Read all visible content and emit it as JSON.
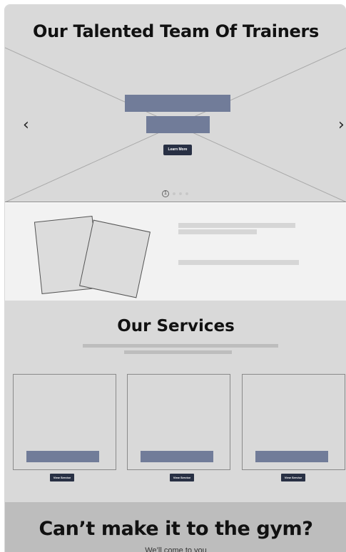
{
  "hero": {
    "title": "Our Talented Team Of Trainers",
    "button_label": "Learn More",
    "arrow_left": "‹",
    "arrow_right": "›",
    "active_slide": "1",
    "slide_count": 4
  },
  "services": {
    "title": "Our Services",
    "cards": [
      {
        "button_label": "View Service"
      },
      {
        "button_label": "View Service"
      },
      {
        "button_label": "View Service"
      }
    ]
  },
  "cta": {
    "title": "Can’t make it to the gym?",
    "subtitle": "We’ll come to you"
  },
  "colors": {
    "placeholder_bar": "#717c99",
    "button_dark": "#283044",
    "section_gray": "#d9d9d9"
  }
}
